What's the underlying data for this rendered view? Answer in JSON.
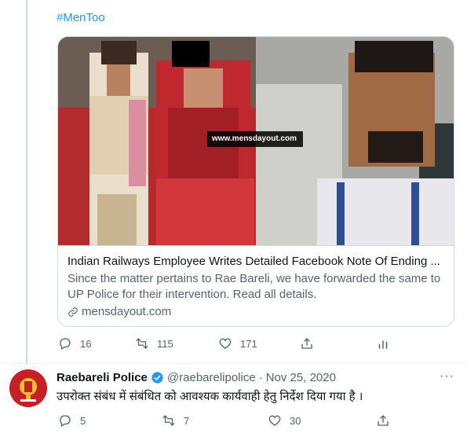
{
  "tweet1": {
    "hashtag": "#MenToo",
    "card": {
      "watermark": "www.mensdayout.com",
      "title": "Indian Railways Employee Writes Detailed Facebook Note Of Ending ...",
      "description": "Since the matter pertains to Rae Bareli, we have forwarded the same to UP Police for their intervention. Read all details.",
      "domain": "mensdayout.com"
    },
    "stats": {
      "replies": "16",
      "retweets": "115",
      "likes": "171"
    }
  },
  "tweet2": {
    "name": "Raebareli Police",
    "handle": "@raebarelipolice",
    "separator": "·",
    "date": "Nov 25, 2020",
    "more": "···",
    "text": "उपरोक्त संबंध में संबंधित को आवश्यक कार्यवाही हेतु निर्देश दिया गया है ।",
    "stats": {
      "replies": "5",
      "retweets": "7",
      "likes": "30"
    }
  },
  "icons": [
    "reply-icon",
    "retweet-icon",
    "like-icon",
    "share-icon",
    "analytics-icon",
    "verified-badge-icon",
    "link-icon",
    "more-icon"
  ],
  "colors": {
    "accent": "#1d9bf0",
    "text": "#0f1419",
    "secondary": "#536471",
    "border": "#cfd9de"
  }
}
